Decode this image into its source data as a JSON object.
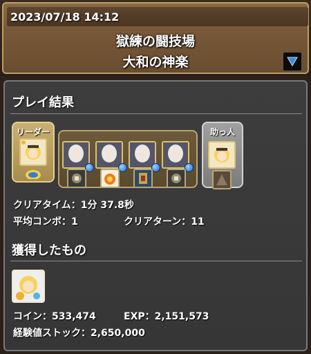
{
  "header": {
    "datetime": "2023/07/18 14:12",
    "dungeon": "獄練の闘技場",
    "floor": "大和の神楽"
  },
  "result": {
    "title": "プレイ結果",
    "leader_tag": "リーダー",
    "helper_tag": "助っ人",
    "clear_time_label": "クリアタイム：1分 37.8秒",
    "avg_combo_label": "平均コンボ：1",
    "clear_turn_label": "クリアターン：11"
  },
  "team": {
    "leader": {
      "monster": "blonde-girl-icon",
      "assist": "blue-shield-icon"
    },
    "subs": [
      {
        "monster": "silver-hair-icon",
        "assist": "mech-icon"
      },
      {
        "monster": "silver-hair-icon",
        "assist": "fire-creature-icon"
      },
      {
        "monster": "silver-hair-icon",
        "assist": "armor-icon"
      },
      {
        "monster": "silver-hair-icon",
        "assist": "mech-icon"
      }
    ],
    "helper": {
      "monster": "blonde-girl-icon",
      "assist": "stone-icon"
    }
  },
  "rewards": {
    "title": "獲得したもの",
    "item": "blonde-girl-icon",
    "coin_label": "コイン：533,474",
    "exp_label": "EXP：2,151,573",
    "stock_label": "経験値ストック：2,650,000"
  },
  "colors": {
    "header_brown": "#7a5b3a",
    "panel_gray": "#3a3a3a",
    "gold_frame": "#c9b072",
    "menu_arrow": "#3b8cd9"
  }
}
